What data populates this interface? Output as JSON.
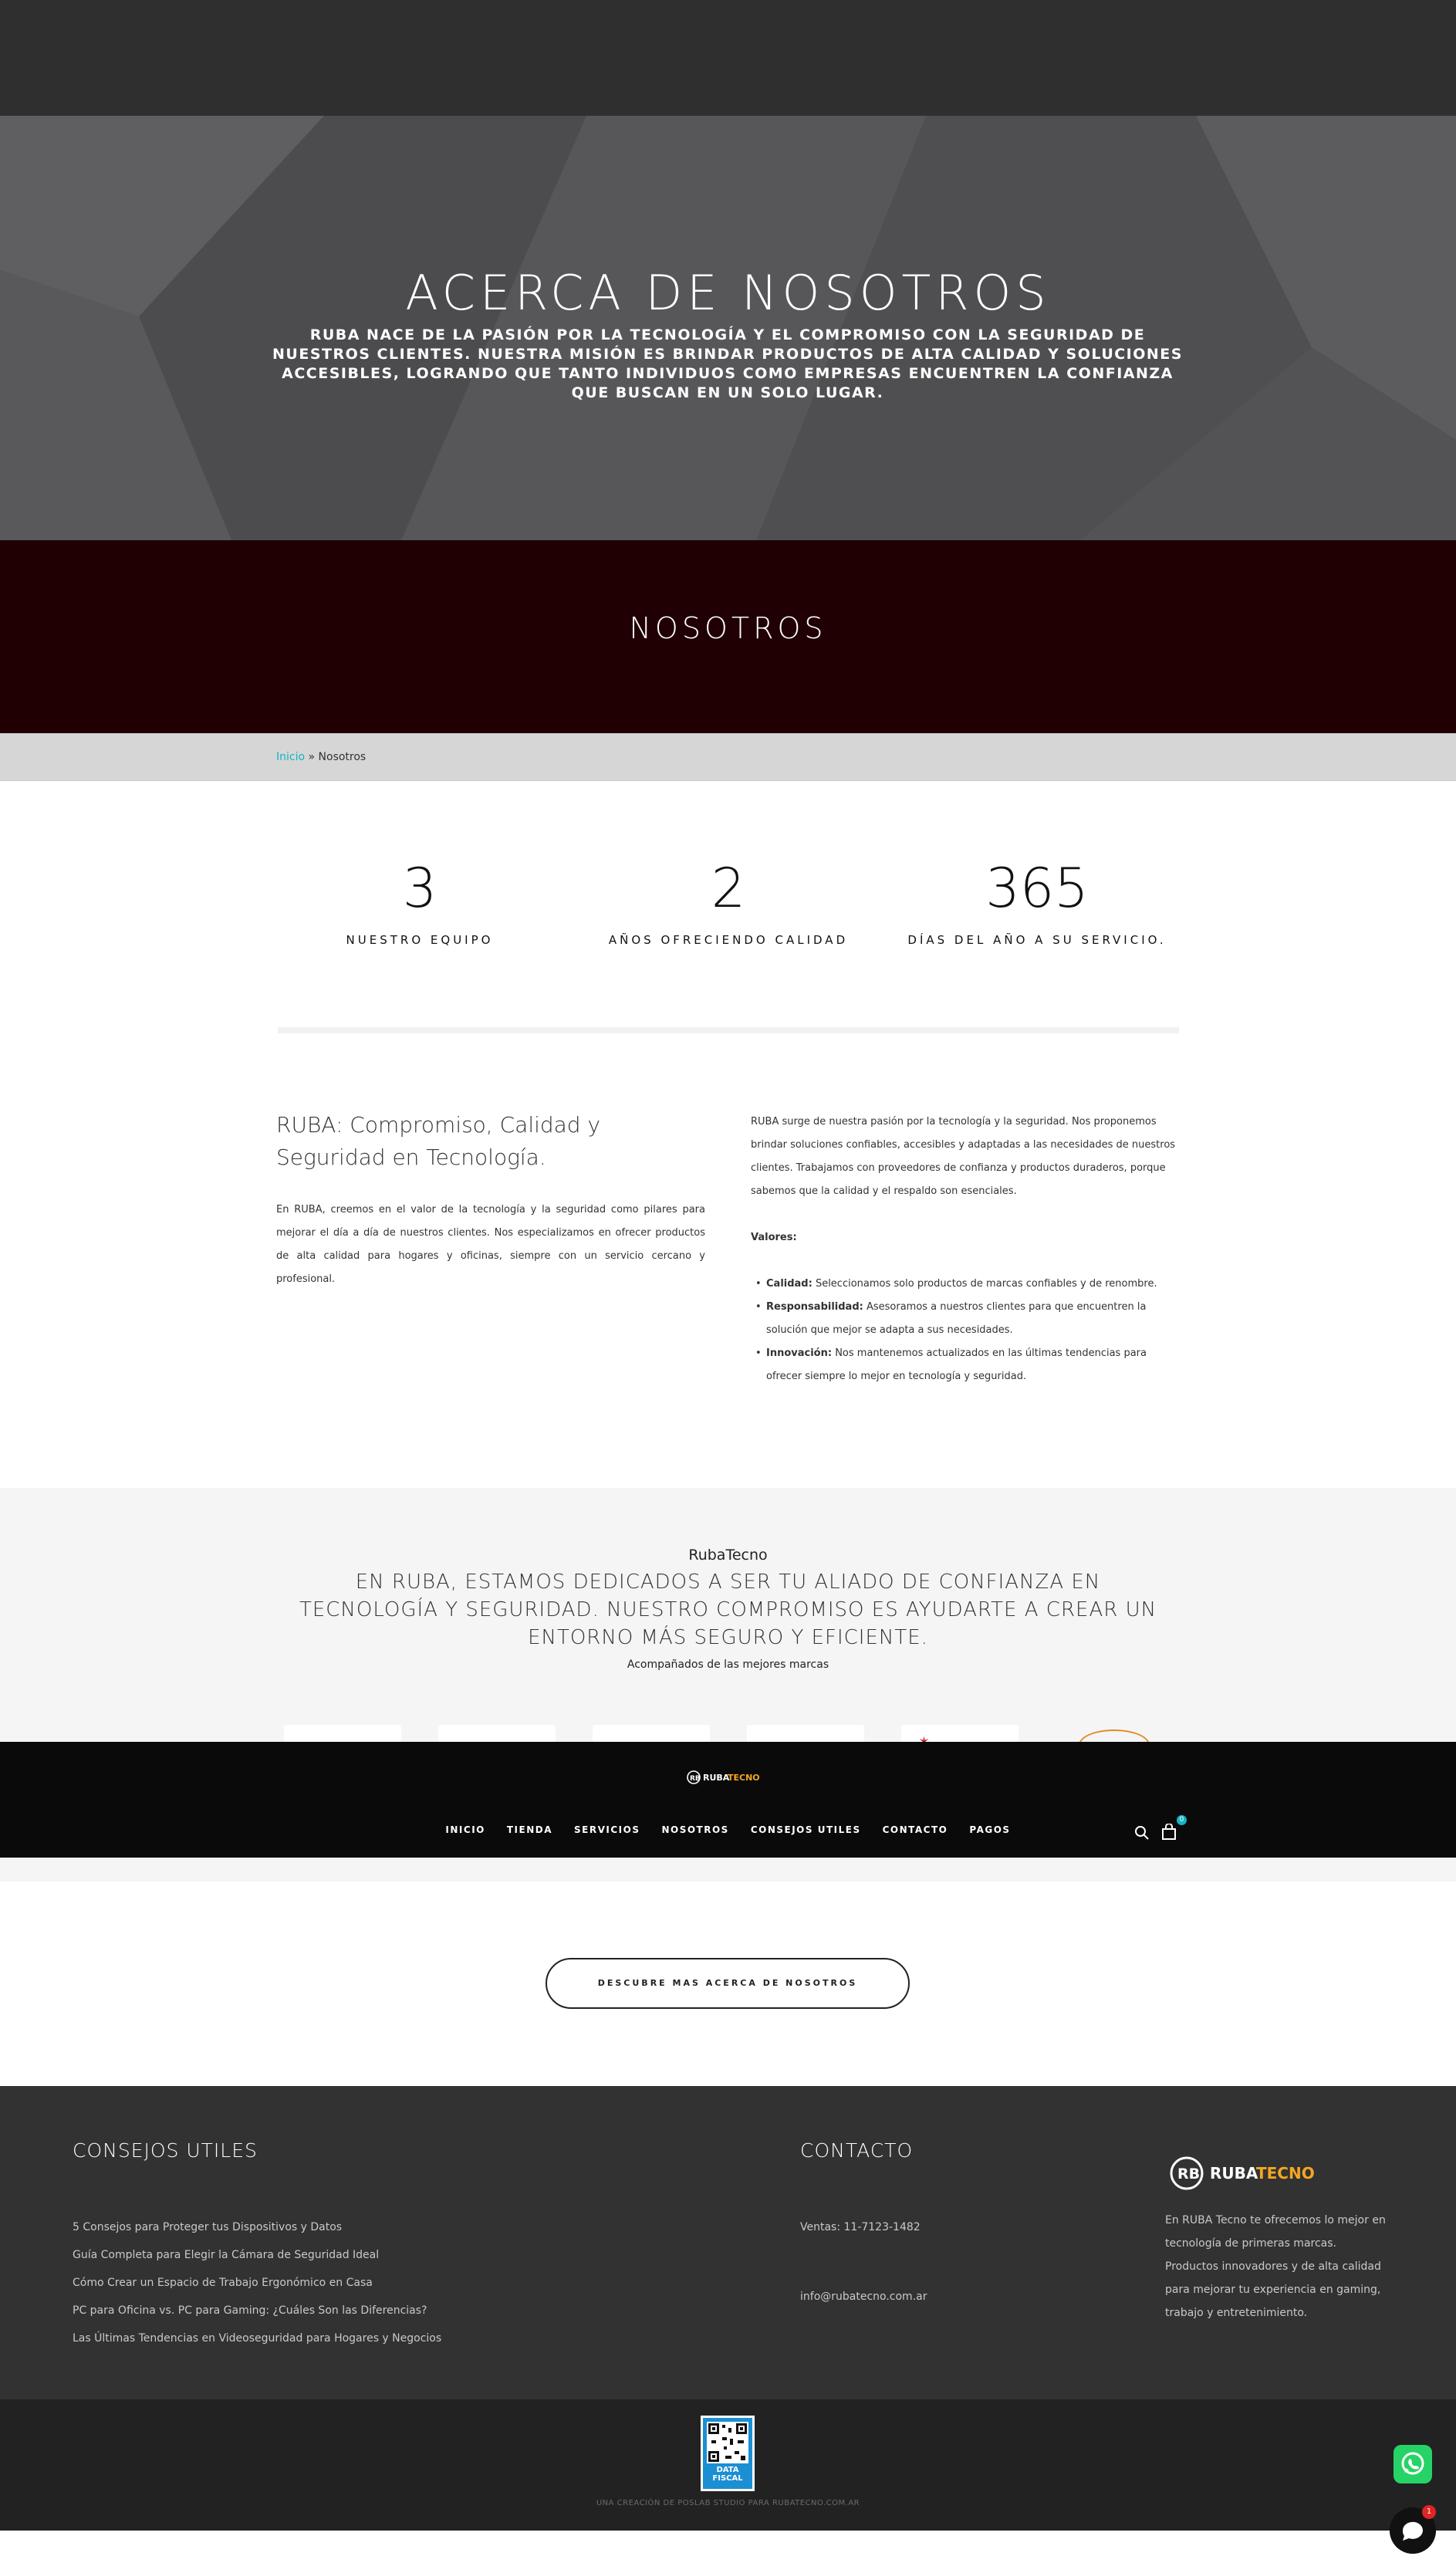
{
  "hero": {
    "title": "ACERCA DE NOSOTROS",
    "text": "RUBA NACE DE LA PASIÓN POR LA TECNOLOGÍA Y EL COMPROMISO CON LA SEGURIDAD DE NUESTROS CLIENTES. NUESTRA MISIÓN ES BRINDAR PRODUCTOS DE ALTA CALIDAD Y SOLUCIONES ACCESIBLES, LOGRANDO QUE TANTO INDIVIDUOS COMO EMPRESAS ENCUENTREN LA CONFIANZA QUE BUSCAN EN UN SOLO LUGAR."
  },
  "banner": {
    "title": "NOSOTROS"
  },
  "breadcrumb": {
    "home": "Inicio",
    "separator": "»",
    "current": "Nosotros"
  },
  "stats": [
    {
      "number": "3",
      "label": "NUESTRO EQUIPO"
    },
    {
      "number": "2",
      "label": "AÑOS OFRECIENDO CALIDAD"
    },
    {
      "number": "365",
      "label": "DÍAS DEL AÑO A SU SERVICIO."
    }
  ],
  "about": {
    "heading": "RUBA: Compromiso, Calidad y Seguridad en Tecnología.",
    "paragraph": "En RUBA, creemos en el valor de la tecnología y la seguridad como pilares para mejorar el día a día de nuestros clientes. Nos especializamos en ofrecer productos de alta calidad para hogares y oficinas, siempre con un servicio cercano y profesional.",
    "right_paragraph": "RUBA surge de nuestra pasión por la tecnología y la seguridad. Nos proponemos brindar soluciones confiables, accesibles y adaptadas a las necesidades de nuestros clientes. Trabajamos con proveedores de confianza y productos duraderos, porque sabemos que la calidad y el respaldo son esenciales.",
    "values_heading": "Valores:",
    "values": [
      {
        "term": "Calidad:",
        "text": " Seleccionamos solo productos de marcas confiables y de renombre."
      },
      {
        "term": "Responsabilidad:",
        "text": " Asesoramos a nuestros clientes para que encuentren la solución que mejor se adapta a sus necesidades."
      },
      {
        "term": "Innovación:",
        "text": " Nos mantenemos actualizados en las últimas tendencias para ofrecer siempre lo mejor en tecnología y seguridad."
      }
    ]
  },
  "brands": {
    "name": "RubaTecno",
    "heading": "EN RUBA, ESTAMOS DEDICADOS A SER TU ALIADO DE CONFIANZA EN TECNOLOGÍA Y SEGURIDAD. NUESTRO COMPROMISO ES AYUDARTE A CREAR UN ENTORNO MÁS SEGURO Y EFICIENTE.",
    "subheading": "Acompañados de las mejores marcas"
  },
  "nav": {
    "logo_text_a": "RUBA",
    "logo_text_b": "TECNO",
    "items": [
      "INICIO",
      "TIENDA",
      "SERVICIOS",
      "NOSOTROS",
      "CONSEJOS UTILES",
      "CONTACTO",
      "PAGOS"
    ],
    "cart_count": "0"
  },
  "cta": {
    "label": "DESCUBRE MAS ACERCA DE NOSOTROS"
  },
  "footer": {
    "tips_heading": "CONSEJOS UTILES",
    "tips": [
      "5 Consejos para Proteger tus Dispositivos y Datos",
      "Guía Completa para Elegir la Cámara de Seguridad Ideal",
      "Cómo Crear un Espacio de Trabajo Ergonómico en Casa",
      "PC para Oficina vs. PC para Gaming: ¿Cuáles Son las Diferencias?",
      "Las Últimas Tendencias en Videoseguridad para Hogares y Negocios"
    ],
    "contact_heading": "CONTACTO",
    "phone": "Ventas: 11-7123-1482",
    "email": "info@rubatecno.com.ar",
    "logo_text_a": "RUBA",
    "logo_text_b": "TECNO",
    "about": "En RUBA Tecno te ofrecemos lo mejor en tecnología de primeras marcas. Productos innovadores y de alta calidad para mejorar tu experiencia en gaming, trabajo y entretenimiento."
  },
  "bottom": {
    "qr_label": "DATA FISCAL",
    "credits": "UNA CREACIÓN DE POSLAB STUDIO PARA RUBATECNO.COM.AR"
  },
  "widgets": {
    "chat_badge": "1"
  },
  "colors": {
    "accent": "#17b3c1",
    "brand_orange": "#f5a623",
    "banner_bg": "#200003",
    "footer_bg": "#323232"
  },
  "icons": [
    "search-icon",
    "cart-icon",
    "whatsapp-icon",
    "chat-icon",
    "qr-code-icon",
    "ruba-logo"
  ]
}
